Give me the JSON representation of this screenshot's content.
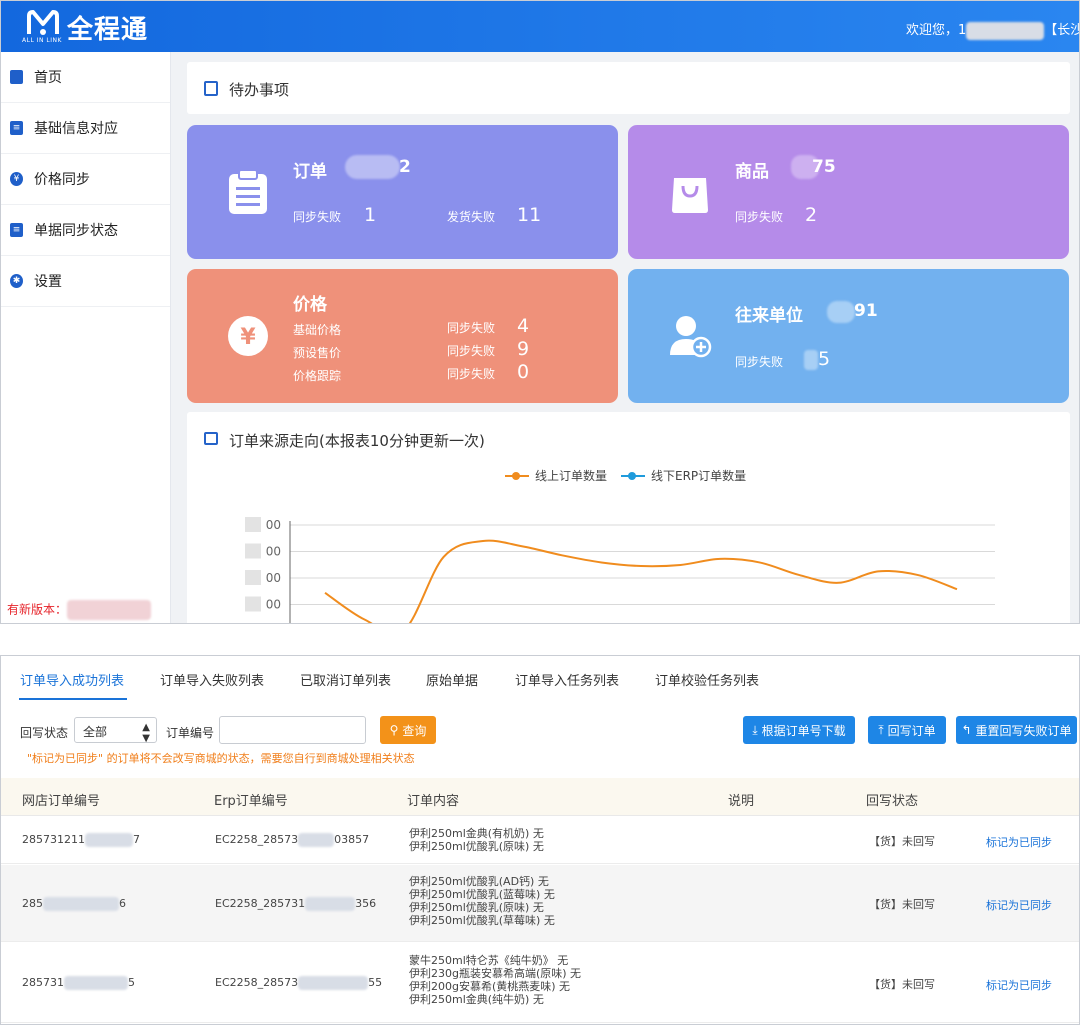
{
  "header": {
    "logo_text": "全程通",
    "logo_sub": "ALL IN LINK",
    "welcome_prefix": "欢迎您，1",
    "welcome_suffix": "【长沙老"
  },
  "sidebar": {
    "items": [
      {
        "label": "首页",
        "icon": "home-icon"
      },
      {
        "label": "基础信息对应",
        "icon": "list-icon"
      },
      {
        "label": "价格同步",
        "icon": "yen-icon"
      },
      {
        "label": "单据同步状态",
        "icon": "document-icon"
      },
      {
        "label": "设置",
        "icon": "gear-icon"
      }
    ],
    "new_version": "有新版本："
  },
  "todo": {
    "title": "待办事项"
  },
  "tiles": {
    "order": {
      "title": "订单",
      "title_suffix": "2",
      "l1": "同步失败",
      "v1": "1",
      "l2": "发货失败",
      "v2": "11"
    },
    "goods": {
      "title": "商品",
      "title_suffix": "75",
      "l1": "同步失败",
      "v1": "2"
    },
    "price": {
      "title": "价格",
      "r1": "基础价格",
      "r2": "预设售价",
      "r3": "价格跟踪",
      "fail": "同步失败",
      "v1": "4",
      "v2": "9",
      "v3": "0"
    },
    "unit": {
      "title": "往来单位",
      "title_suffix": "91",
      "l1": "同步失败",
      "v1": "5"
    }
  },
  "chart_card": {
    "title": "订单来源走向(本报表10分钟更新一次)",
    "legend": [
      "线上订单数量",
      "线下ERP订单数量"
    ],
    "yticks": [
      "00",
      "00",
      "00",
      "00"
    ]
  },
  "chart_data": {
    "type": "line",
    "title": "订单来源走向(本报表10分钟更新一次)",
    "series": [
      {
        "name": "线上订单数量",
        "color": "#f08c1e",
        "values": [
          310,
          235,
          205,
          410,
          455,
          440,
          415,
          395,
          385,
          388,
          405,
          395,
          360,
          338,
          370,
          360,
          320
        ]
      },
      {
        "name": "线下ERP订单数量",
        "color": "#1f9bdc",
        "values": []
      }
    ],
    "ylim": [
      200,
      500
    ],
    "grid": true,
    "legend_position": "top-center"
  },
  "list_page": {
    "tabs": [
      "订单导入成功列表",
      "订单导入失败列表",
      "已取消订单列表",
      "原始单据",
      "订单导入任务列表",
      "订单校验任务列表"
    ],
    "filters": {
      "status_label": "回写状态",
      "status_value": "全部",
      "order_label": "订单编号",
      "order_value": "",
      "search_btn": "查询"
    },
    "actions": {
      "download": "根据订单号下载",
      "writeback": "回写订单",
      "reset": "重置回写失败订单"
    },
    "notice": "\"标记为已同步\" 的订单将不会改写商城的状态，需要您自行到商城处理相关状态",
    "columns": [
      "网店订单编号",
      "Erp订单编号",
      "订单内容",
      "说明",
      "回写状态"
    ],
    "rows": [
      {
        "shop_id": "285731211",
        "shop_tail": "7",
        "erp_id": "EC2258_28573",
        "erp_tail": "03857",
        "content": [
          "伊利250ml金典(有机奶) 无",
          "伊利250ml优酸乳(原味) 无"
        ],
        "status": "【货】未回写",
        "action": "标记为已同步"
      },
      {
        "shop_id": "285",
        "shop_tail": "6",
        "erp_id": "EC2258_285731",
        "erp_tail": "356",
        "content": [
          "伊利250ml优酸乳(AD钙) 无",
          "伊利250ml优酸乳(蓝莓味) 无",
          "伊利250ml优酸乳(原味) 无",
          "伊利250ml优酸乳(草莓味) 无"
        ],
        "status": "【货】未回写",
        "action": "标记为已同步"
      },
      {
        "shop_id": "285731",
        "shop_tail": "5",
        "erp_id": "EC2258_28573",
        "erp_tail": "55",
        "content": [
          "蒙牛250ml特仑苏《纯牛奶》 无",
          "伊利230g瓶装安慕希高端(原味) 无",
          "伊利200g安慕希(黄桃燕麦味) 无",
          "伊利250ml金典(纯牛奶) 无"
        ],
        "status": "【货】未回写",
        "action": "标记为已同步"
      }
    ]
  }
}
